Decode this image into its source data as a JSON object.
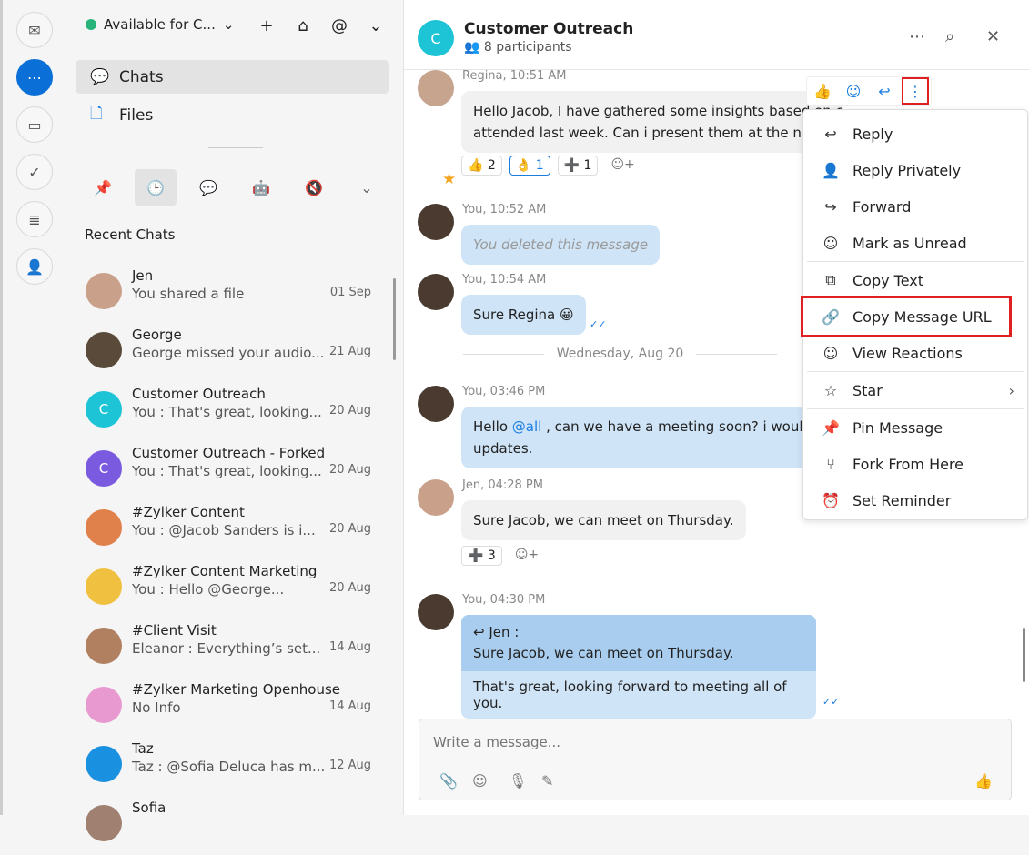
{
  "rail": [
    {
      "icon": "mail-icon",
      "g": "✉"
    },
    {
      "icon": "chat-icon",
      "g": "⋯",
      "active": true
    },
    {
      "icon": "wallet-icon",
      "g": "▭"
    },
    {
      "icon": "tasks-icon",
      "g": "✓"
    },
    {
      "icon": "document-icon",
      "g": "≣"
    },
    {
      "icon": "contacts-icon",
      "g": "👤"
    }
  ],
  "sidebar": {
    "status": "Available for C...",
    "nav": [
      {
        "label": "Chats",
        "icon": "chat-bubble-icon",
        "g": "💬"
      },
      {
        "label": "Files",
        "icon": "file-icon",
        "g": "🗋"
      }
    ],
    "recent_label": "Recent Chats",
    "chats": [
      {
        "name": "Jen",
        "preview": "You shared a file",
        "date": "01 Sep",
        "color": "#c9a08a"
      },
      {
        "name": "George",
        "preview": "George missed your audio...",
        "date": "21 Aug",
        "color": "#5a4a3a"
      },
      {
        "name": "Customer Outreach",
        "preview": "You : That's great, looking...",
        "date": "20 Aug",
        "color": "#1cc4d6",
        "initial": "C"
      },
      {
        "name": "Customer Outreach - Forked",
        "preview": "You : That's great, looking...",
        "date": "20 Aug",
        "color": "#7a5be0",
        "initial": "C"
      },
      {
        "name": "#Zylker Content",
        "preview": "You : @Jacob Sanders  is i...",
        "date": "20 Aug",
        "color": "#e0804a"
      },
      {
        "name": "#Zylker Content Marketing",
        "preview": "You : Hello @George...",
        "date": "20 Aug",
        "color": "#f0c040"
      },
      {
        "name": "#Client Visit",
        "preview": "Eleanor : Everything’s set...",
        "date": "14 Aug",
        "color": "#b08060"
      },
      {
        "name": "#Zylker Marketing Openhouse",
        "preview": "No Info",
        "date": "14 Aug",
        "color": "#e89ad0"
      },
      {
        "name": "Taz",
        "preview": "Taz : @Sofia Deluca has m...",
        "date": "12 Aug",
        "color": "#1a90e0"
      },
      {
        "name": "Sofia",
        "preview": "",
        "date": "",
        "color": "#a08070"
      }
    ]
  },
  "chat": {
    "title": "Customer Outreach",
    "initial": "C",
    "participants": "8 participants",
    "messages": [
      {
        "meta": "Regina, 10:51 AM",
        "text1": "Hello Jacob, I have gathered some insights based on customer calls i",
        "text2": "attended last week. Can i present them at the next"
      },
      {
        "meta": "You, 10:52 AM",
        "text": "You deleted this message"
      },
      {
        "meta": "You, 10:54 AM",
        "text": "Sure Regina 😀"
      },
      {
        "meta": "You, 03:46 PM",
        "text1a": "Hello ",
        "mention": "@all",
        "text1b": " , can we have a meeting soon? i would l",
        "text2": "updates."
      },
      {
        "meta": "Jen, 04:28 PM",
        "text": "Sure Jacob, we can meet on Thursday."
      },
      {
        "meta": "You, 04:30 PM",
        "quote_author": "Jen :",
        "quote": "Sure Jacob, we can meet on Thursday.",
        "text": "That's great, looking forward to meeting all of you."
      }
    ],
    "reactions1": [
      {
        "e": "👍",
        "n": "2"
      },
      {
        "e": "👌",
        "n": "1",
        "sel": true
      },
      {
        "e": "➕",
        "n": "1"
      }
    ],
    "reactions2": [
      {
        "e": "➕",
        "n": "3"
      }
    ],
    "date_sep": "Wednesday, Aug 20",
    "composer_placeholder": "Write a message..."
  },
  "menu": [
    {
      "label": "Reply",
      "icon": "reply-icon",
      "g": "↩"
    },
    {
      "label": "Reply Privately",
      "icon": "reply-private-icon",
      "g": "👤"
    },
    {
      "label": "Forward",
      "icon": "forward-icon",
      "g": "↪"
    },
    {
      "label": "Mark as Unread",
      "icon": "mark-unread-icon",
      "g": "☺"
    },
    {
      "label": "Copy Text",
      "icon": "copy-icon",
      "g": "⧉",
      "sep": true
    },
    {
      "label": "Copy Message URL",
      "icon": "link-icon",
      "g": "🔗",
      "hl": true
    },
    {
      "label": "View Reactions",
      "icon": "smiley-icon",
      "g": "☺"
    },
    {
      "label": "Star",
      "icon": "star-icon",
      "g": "☆",
      "sep": true,
      "sub": true
    },
    {
      "label": "Pin Message",
      "icon": "pin-icon",
      "g": "📌",
      "sep": true
    },
    {
      "label": "Fork From Here",
      "icon": "fork-icon",
      "g": "⑂"
    },
    {
      "label": "Set Reminder",
      "icon": "alarm-icon",
      "g": "⏰"
    }
  ]
}
